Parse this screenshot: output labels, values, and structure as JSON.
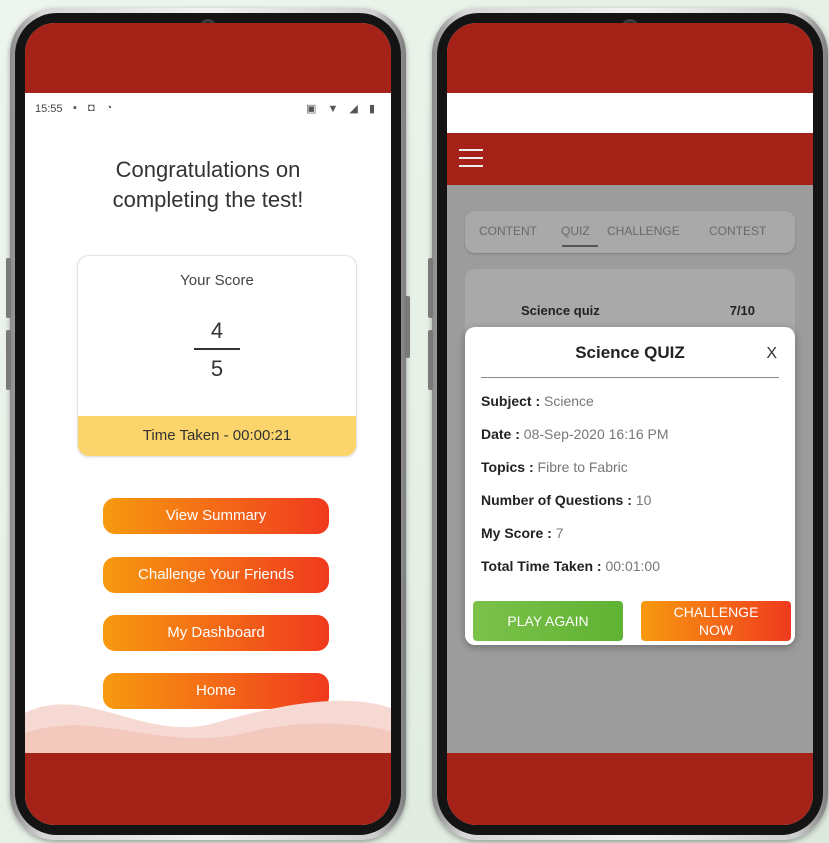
{
  "left_phone": {
    "status": {
      "time": "15:55"
    },
    "heading_line1": "Congratulations on",
    "heading_line2": "completing the test!",
    "score_label": "Your Score",
    "score_numerator": "4",
    "score_denominator": "5",
    "time_taken": "Time Taken - 00:00:21",
    "buttons": [
      "View Summary",
      "Challenge Your Friends",
      "My Dashboard",
      "Home"
    ]
  },
  "right_phone": {
    "tabs": [
      "CONTENT",
      "QUIZ",
      "CHALLENGE",
      "CONTEST"
    ],
    "active_tab": "QUIZ",
    "quiz_item": {
      "name": "Science quiz",
      "score": "7/10"
    },
    "modal": {
      "title": "Science QUIZ",
      "close": "X",
      "rows": [
        {
          "label": "Subject :",
          "value": "Science"
        },
        {
          "label": "Date :",
          "value": "08-Sep-2020 16:16 PM"
        },
        {
          "label": "Topics :",
          "value": "Fibre to Fabric"
        },
        {
          "label": "Number of Questions :",
          "value": "10"
        },
        {
          "label": "My Score :",
          "value": "7"
        },
        {
          "label": "Total Time Taken :",
          "value": "00:01:00"
        }
      ],
      "play_again": "PLAY AGAIN",
      "challenge_line1": "CHALLENGE",
      "challenge_line2": "NOW"
    }
  },
  "colors": {
    "brand_red": "#a52219",
    "orange": "#f79a0f",
    "red_orange": "#f03a1e",
    "score_strip": "#fbd56b",
    "green": "#7cc24a"
  }
}
